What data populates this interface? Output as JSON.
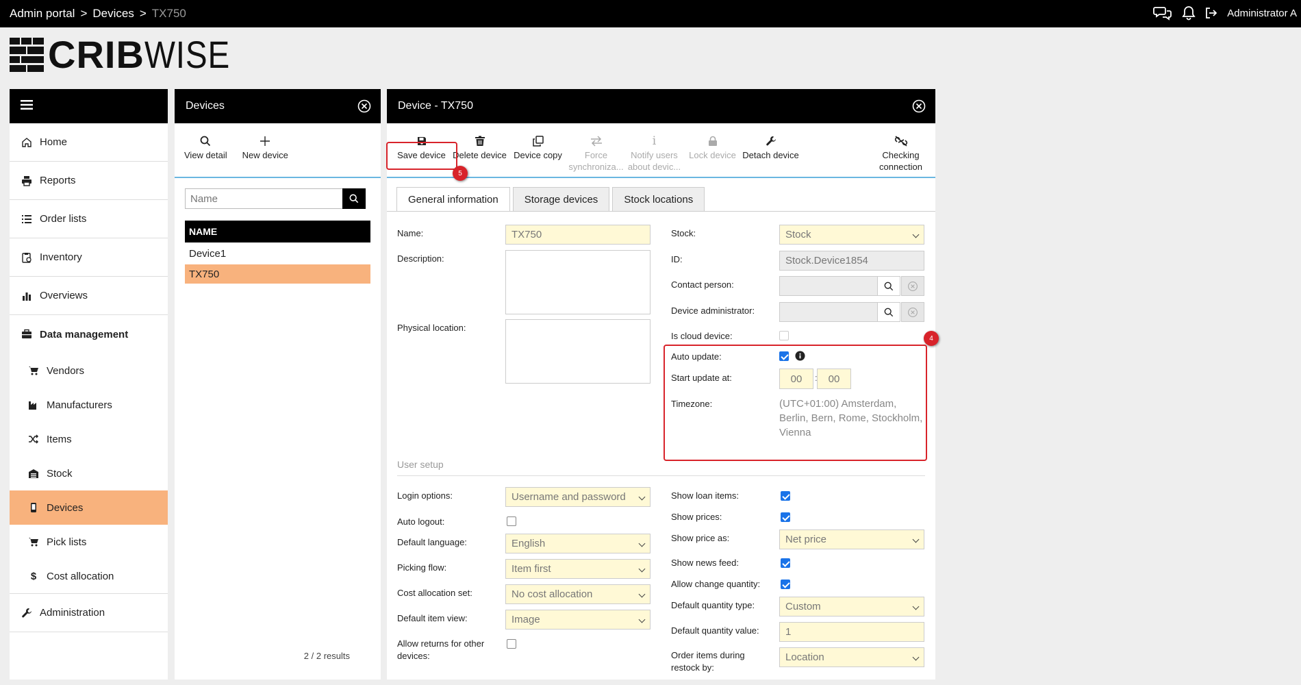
{
  "breadcrumb": {
    "items": [
      "Admin portal",
      "Devices"
    ],
    "current": "TX750",
    "separator": ">"
  },
  "user": {
    "name": "Administrator A"
  },
  "icons": {
    "chat": "chat-icon",
    "bell": "bell-icon",
    "logout": "logout-icon"
  },
  "logo": {
    "bold": "CRIB",
    "light": "WISE"
  },
  "sidebar": {
    "items": [
      {
        "label": "Home",
        "icon": "home-icon"
      },
      {
        "label": "Reports",
        "icon": "printer-icon"
      },
      {
        "label": "Order lists",
        "icon": "list-icon"
      },
      {
        "label": "Inventory",
        "icon": "clipboard-icon"
      },
      {
        "label": "Overviews",
        "icon": "bar-chart-icon"
      }
    ],
    "section": {
      "label": "Data management",
      "icon": "briefcase-icon"
    },
    "subitems": [
      {
        "label": "Vendors",
        "icon": "cart-icon"
      },
      {
        "label": "Manufacturers",
        "icon": "factory-icon"
      },
      {
        "label": "Items",
        "icon": "shuffle-icon"
      },
      {
        "label": "Stock",
        "icon": "warehouse-icon"
      },
      {
        "label": "Devices",
        "icon": "mobile-icon",
        "active": true
      },
      {
        "label": "Pick lists",
        "icon": "cart-icon"
      },
      {
        "label": "Cost allocation",
        "icon": "dollar-icon"
      }
    ],
    "admin": {
      "label": "Administration",
      "icon": "wrench-icon"
    }
  },
  "devices_panel": {
    "title": "Devices",
    "toolbar": {
      "view_detail": "View detail",
      "new_device": "New device"
    },
    "search_placeholder": "Name",
    "column_header": "NAME",
    "rows": [
      "Device1",
      "TX750"
    ],
    "selected": "TX750",
    "results": "2 / 2 results"
  },
  "detail_panel": {
    "title": "Device - TX750",
    "toolbar": [
      {
        "label": "Save device",
        "icon": "save-icon",
        "enabled": true
      },
      {
        "label": "Delete device",
        "icon": "trash-icon",
        "enabled": true
      },
      {
        "label": "Device copy",
        "icon": "copy-icon",
        "enabled": true
      },
      {
        "label": "Force synchroniza...",
        "icon": "sync-icon",
        "enabled": false
      },
      {
        "label": "Notify users about devic...",
        "icon": "info-icon",
        "enabled": false
      },
      {
        "label": "Lock device",
        "icon": "lock-icon",
        "enabled": false
      },
      {
        "label": "Detach device",
        "icon": "wrench-icon",
        "enabled": true
      },
      {
        "label": "Checking connection",
        "icon": "unlink-icon",
        "enabled": true
      }
    ],
    "tabs": [
      "General information",
      "Storage devices",
      "Stock locations"
    ],
    "active_tab": "General information",
    "general": {
      "name_label": "Name:",
      "name_value": "TX750",
      "description_label": "Description:",
      "physical_location_label": "Physical location:",
      "stock_label": "Stock:",
      "stock_value": "Stock",
      "id_label": "ID:",
      "id_value": "Stock.Device1854",
      "contact_label": "Contact person:",
      "admin_label": "Device administrator:",
      "cloud_label": "Is cloud device:",
      "cloud_checked": false,
      "auto_update_label": "Auto update:",
      "auto_update_checked": true,
      "start_update_label": "Start update at:",
      "start_hour": "00",
      "start_min": "00",
      "time_sep": ":",
      "timezone_label": "Timezone:",
      "timezone_value": "(UTC+01:00) Amsterdam, Berlin, Bern, Rome, Stockholm, Vienna"
    },
    "user_setup": {
      "title": "User setup",
      "login_label": "Login options:",
      "login_value": "Username and password",
      "auto_logout_label": "Auto logout:",
      "auto_logout_checked": false,
      "language_label": "Default language:",
      "language_value": "English",
      "picking_label": "Picking flow:",
      "picking_value": "Item first",
      "cost_label": "Cost allocation set:",
      "cost_value": "No cost allocation",
      "item_view_label": "Default item view:",
      "item_view_value": "Image",
      "returns_label": "Allow returns for other devices:",
      "returns_checked": false,
      "loan_label": "Show loan items:",
      "loan_checked": true,
      "prices_label": "Show prices:",
      "prices_checked": true,
      "price_as_label": "Show price as:",
      "price_as_value": "Net price",
      "news_label": "Show news feed:",
      "news_checked": true,
      "change_qty_label": "Allow change quantity:",
      "change_qty_checked": true,
      "qty_type_label": "Default quantity type:",
      "qty_type_value": "Custom",
      "qty_value_label": "Default quantity value:",
      "qty_value": "1",
      "order_label": "Order items during restock by:",
      "order_value": "Location"
    }
  },
  "annotations": [
    {
      "number": "5",
      "target": "Save device"
    },
    {
      "number": "4",
      "target": "Auto update settings"
    }
  ],
  "colors": {
    "accent": "#f8b27d",
    "annotation": "#d8232a",
    "field": "#fff9d6",
    "divider": "#6ab6e0"
  }
}
